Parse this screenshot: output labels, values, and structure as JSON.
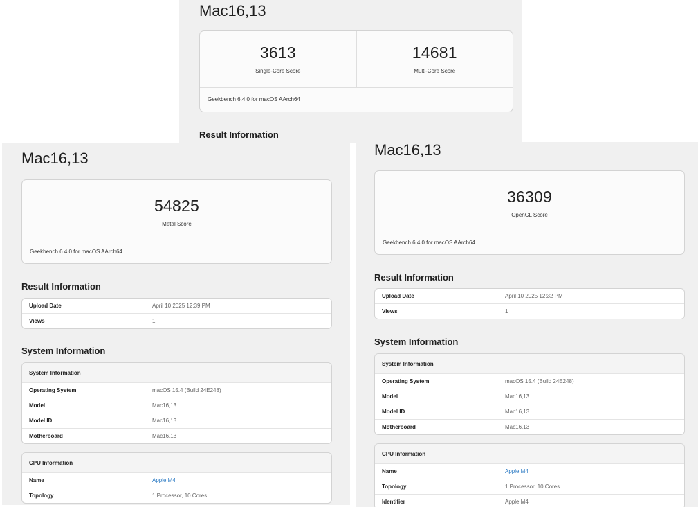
{
  "top": {
    "title": "Mac16,13",
    "scores": [
      {
        "value": "3613",
        "label": "Single-Core Score"
      },
      {
        "value": "14681",
        "label": "Multi-Core Score"
      }
    ],
    "footer": "Geekbench 6.4.0 for macOS AArch64",
    "section_result": "Result Information"
  },
  "left": {
    "title": "Mac16,13",
    "score": {
      "value": "54825",
      "label": "Metal Score"
    },
    "footer": "Geekbench 6.4.0 for macOS AArch64",
    "section_result": "Result Information",
    "result_rows": [
      {
        "key": "Upload Date",
        "value": "April 10 2025 12:39 PM"
      },
      {
        "key": "Views",
        "value": "1"
      }
    ],
    "section_system": "System Information",
    "system_header": "System Information",
    "system_rows": [
      {
        "key": "Operating System",
        "value": "macOS 15.4 (Build 24E248)"
      },
      {
        "key": "Model",
        "value": "Mac16,13"
      },
      {
        "key": "Model ID",
        "value": "Mac16,13"
      },
      {
        "key": "Motherboard",
        "value": "Mac16,13"
      }
    ],
    "cpu_header": "CPU Information",
    "cpu_rows": [
      {
        "key": "Name",
        "value": "Apple M4"
      },
      {
        "key": "Topology",
        "value": "1 Processor, 10 Cores"
      }
    ]
  },
  "right": {
    "title": "Mac16,13",
    "score": {
      "value": "36309",
      "label": "OpenCL Score"
    },
    "footer": "Geekbench 6.4.0 for macOS AArch64",
    "section_result": "Result Information",
    "result_rows": [
      {
        "key": "Upload Date",
        "value": "April 10 2025 12:32 PM"
      },
      {
        "key": "Views",
        "value": "1"
      }
    ],
    "section_system": "System Information",
    "system_header": "System Information",
    "system_rows": [
      {
        "key": "Operating System",
        "value": "macOS 15.4 (Build 24E248)"
      },
      {
        "key": "Model",
        "value": "Mac16,13"
      },
      {
        "key": "Model ID",
        "value": "Mac16,13"
      },
      {
        "key": "Motherboard",
        "value": "Mac16,13"
      }
    ],
    "cpu_header": "CPU Information",
    "cpu_rows": [
      {
        "key": "Name",
        "value": "Apple M4"
      },
      {
        "key": "Topology",
        "value": "1 Processor, 10 Cores"
      },
      {
        "key": "Identifier",
        "value": "Apple M4"
      }
    ]
  },
  "colors": {
    "link": "#2c7bc4",
    "panel_bg": "#f0f0f0",
    "card_bg": "#fbfbfb"
  }
}
